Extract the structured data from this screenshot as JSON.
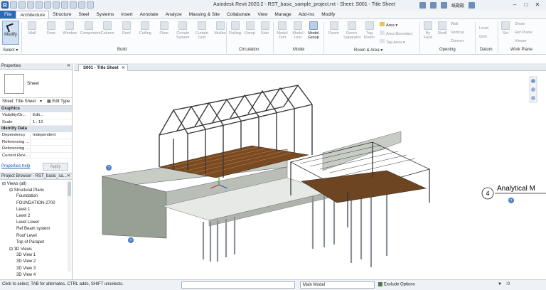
{
  "window": {
    "title": "Autodesk Revit 2020.2 - RST_basic_sample_project.rvt - Sheet: S001 - Title Sheet",
    "user": "纸殿殿"
  },
  "menu_tabs": [
    "File",
    "Architecture",
    "Structure",
    "Steel",
    "Systems",
    "Insert",
    "Annotate",
    "Analyze",
    "Massing & Site",
    "Collaborate",
    "View",
    "Manage",
    "Add-Ins",
    "Modify"
  ],
  "active_tab": "Architecture",
  "ribbon": {
    "modify_label": "Modify",
    "select_label": "Select ▾",
    "build": {
      "panel": "Build",
      "buttons": [
        "Wall",
        "Door",
        "Window",
        "Component",
        "Column",
        "Roof",
        "Ceiling",
        "Floor",
        "Curtain System",
        "Curtain Grid",
        "Mullion"
      ]
    },
    "circulation": {
      "panel": "Circulation",
      "buttons": [
        "Railing",
        "Ramp",
        "Stair"
      ]
    },
    "model": {
      "panel": "Model",
      "buttons": [
        "Model Text",
        "Model Line",
        "Model Group"
      ]
    },
    "room_area": {
      "panel": "Room & Area ▾",
      "buttons": [
        "Room",
        "Room Separator",
        "Tag Room"
      ],
      "rows": [
        "Area ▾",
        "Area Boundary",
        "Tag Area ▾"
      ]
    },
    "opening": {
      "panel": "Opening",
      "buttons": [
        "By Face",
        "Shaft"
      ],
      "rows": [
        "Wall",
        "Vertical",
        "Dormer"
      ]
    },
    "datum": {
      "panel": "Datum",
      "rows": [
        "Level",
        "Grid"
      ]
    },
    "work_plane": {
      "panel": "Work Plane",
      "buttons": [
        "Set"
      ],
      "rows": [
        "Show",
        "Ref Plane",
        "Viewer"
      ]
    }
  },
  "properties": {
    "header": "Properties",
    "type_name": "Sheet",
    "selector": "Sheet: Title Sheet",
    "edit_type": "Edit Type",
    "groups": [
      {
        "name": "Graphics",
        "rows": [
          {
            "k": "Visibility/Gr...",
            "v": "Edit..."
          },
          {
            "k": "Scale",
            "v": "1 : 10"
          }
        ]
      },
      {
        "name": "Identity Data",
        "rows": [
          {
            "k": "Dependency",
            "v": "Independent"
          },
          {
            "k": "Referencing ...",
            "v": ""
          },
          {
            "k": "Referencing ...",
            "v": ""
          },
          {
            "k": "Current Revi...",
            "v": ""
          }
        ]
      }
    ],
    "help_link": "Properties help",
    "apply": "Apply"
  },
  "project_browser": {
    "header": "Project Browser - RST_basic_sa...",
    "nodes": [
      {
        "label": "Views (all)",
        "level": 0,
        "expanded": true
      },
      {
        "label": "Structural Plans",
        "level": 1,
        "expanded": true
      },
      {
        "label": "Foundation",
        "level": 2
      },
      {
        "label": "FOUNDATION-2700",
        "level": 2
      },
      {
        "label": "Level 1",
        "level": 2
      },
      {
        "label": "Level 2",
        "level": 2
      },
      {
        "label": "Level Lower",
        "level": 2
      },
      {
        "label": "Ref Beam system",
        "level": 2
      },
      {
        "label": "Roof Level",
        "level": 2
      },
      {
        "label": "Top of Parapet",
        "level": 2
      },
      {
        "label": "3D Views",
        "level": 1,
        "expanded": true
      },
      {
        "label": "3D View 1",
        "level": 2
      },
      {
        "label": "3D View 2",
        "level": 2
      },
      {
        "label": "3D View 3",
        "level": 2
      },
      {
        "label": "3D View 4",
        "level": 2
      }
    ]
  },
  "view": {
    "tab": "S001 - Title Sheet",
    "section_marker": "4",
    "section_label": "Analytical M",
    "help_marker": "?"
  },
  "status_bar": {
    "hint": "Click to select, TAB for alternates, CTRL adds, SHIFT unselects.",
    "model": "Main Model",
    "exclude": "Exclude Options",
    "zoom": ":0"
  },
  "colors": {
    "accent": "#2a6ab8",
    "deck": "#7a4a22",
    "steel": "#3a3a3a",
    "wall": "#9aa39a"
  }
}
